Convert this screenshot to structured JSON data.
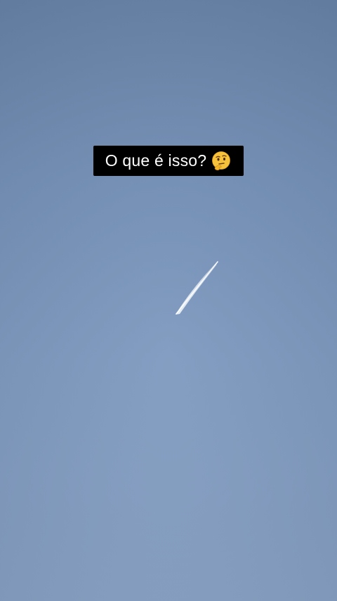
{
  "caption": {
    "text": "O que é isso?",
    "emoji": "thinking-face-emoji"
  },
  "scene": {
    "subject": "airplane-contrail",
    "sky_color_top": "#6783a8",
    "sky_color_bottom": "#859fc2",
    "caption_bg": "#000000",
    "caption_fg": "#ffffff"
  }
}
